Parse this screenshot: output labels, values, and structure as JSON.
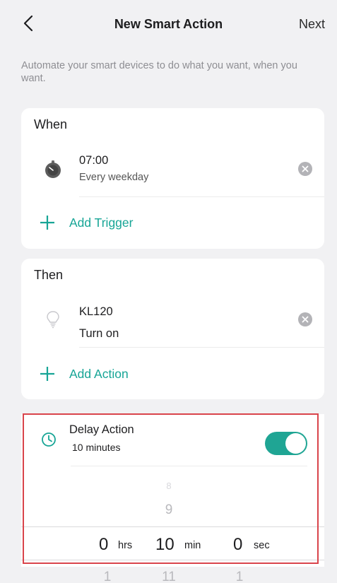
{
  "header": {
    "title": "New Smart Action",
    "next_label": "Next"
  },
  "subtitle": "Automate your smart devices to do what you want, when you want.",
  "when": {
    "title": "When",
    "trigger": {
      "time": "07:00",
      "repeat": "Every weekday"
    },
    "add_label": "Add Trigger"
  },
  "then": {
    "title": "Then",
    "action": {
      "device": "KL120",
      "state": "Turn on"
    },
    "add_label": "Add Action"
  },
  "delay": {
    "title": "Delay Action",
    "summary": "10 minutes",
    "enabled": true,
    "picker": {
      "above_faint": "8",
      "above": "9",
      "hours": "0",
      "hours_unit": "hrs",
      "minutes": "10",
      "minutes_unit": "min",
      "seconds": "0",
      "seconds_unit": "sec",
      "below_hours": "1",
      "below_minutes": "11",
      "below_seconds": "1"
    }
  },
  "colors": {
    "accent": "#17a596",
    "highlight": "#d9444b",
    "background": "#f1f1f3"
  }
}
